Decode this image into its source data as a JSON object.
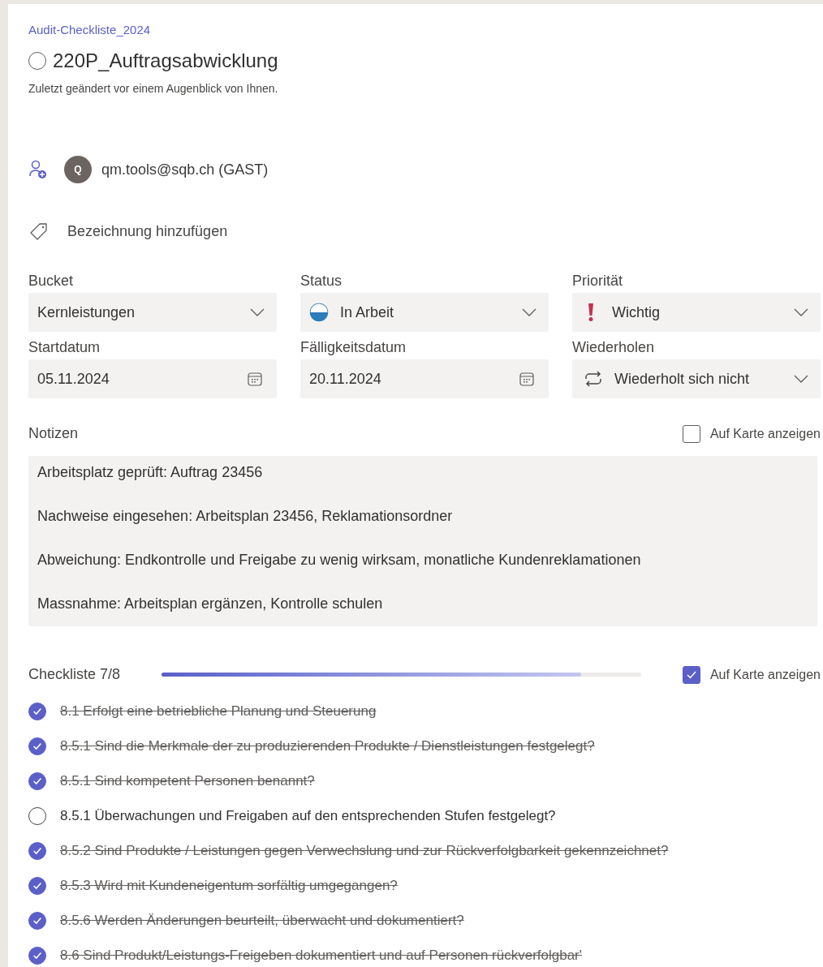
{
  "plan_name": "Audit-Checkliste_2024",
  "task": {
    "title": "220P_Auftragsabwicklung",
    "completed": false,
    "modified": "Zuletzt geändert vor einem Augenblick von Ihnen."
  },
  "assignee": {
    "initial": "Q",
    "name": "qm.tools@sqb.ch (GAST)"
  },
  "label_action": "Bezeichnung hinzufügen",
  "fields": [
    {
      "label": "Bucket",
      "value": "Kernleistungen",
      "kind": "dropdown"
    },
    {
      "label": "Status",
      "value": "In Arbeit",
      "kind": "status"
    },
    {
      "label": "Priorität",
      "value": "Wichtig",
      "kind": "priority"
    },
    {
      "label": "Startdatum",
      "value": "05.11.2024",
      "kind": "date"
    },
    {
      "label": "Fälligkeitsdatum",
      "value": "20.11.2024",
      "kind": "date"
    },
    {
      "label": "Wiederholen",
      "value": "Wiederholt sich nicht",
      "kind": "repeat"
    }
  ],
  "notes": {
    "label": "Notizen",
    "show_on_card": {
      "label": "Auf Karte anzeigen",
      "checked": false
    },
    "lines": [
      "Arbeitsplatz geprüft: Auftrag 23456",
      "Nachweise eingesehen: Arbeitsplan 23456, Reklamationsordner",
      "Abweichung: Endkontrolle und Freigabe zu wenig wirksam, monatliche Kundenreklamationen",
      "Massnahme: Arbeitsplan ergänzen, Kontrolle schulen"
    ]
  },
  "checklist": {
    "label": "Checkliste 7/8",
    "level": 0.875,
    "show_on_card": {
      "label": "Auf Karte anzeigen",
      "checked": true
    },
    "items": [
      {
        "text": "8.1 Erfolgt eine betriebliche Planung und Steuerung",
        "checked": true
      },
      {
        "text": "8.5.1 Sind die Merkmale der zu produzierenden Produkte / Dienstleistungen festgelegt?",
        "checked": true
      },
      {
        "text": "8.5.1 Sind kompetent Personen benannt?",
        "checked": true
      },
      {
        "text": "8.5.1 Überwachungen und Freigaben auf den entsprechenden Stufen festgelegt?",
        "checked": false
      },
      {
        "text": "8.5.2 Sind Produkte / Leistungen gegen Verwechslung und zur Rückverfolgbarkeit gekennzeichnet?",
        "checked": true
      },
      {
        "text": "8.5.3 Wird mit Kundeneigentum sorfältig umgegangen?",
        "checked": true
      },
      {
        "text": "8.5.6 Werden Änderungen beurteilt, überwacht und dokumentiert?",
        "checked": true
      },
      {
        "text": "8.6 Sind Produkt/Leistungs-Freigeben dokumentiert und auf Personen rückverfolgbar'",
        "checked": true
      }
    ]
  }
}
